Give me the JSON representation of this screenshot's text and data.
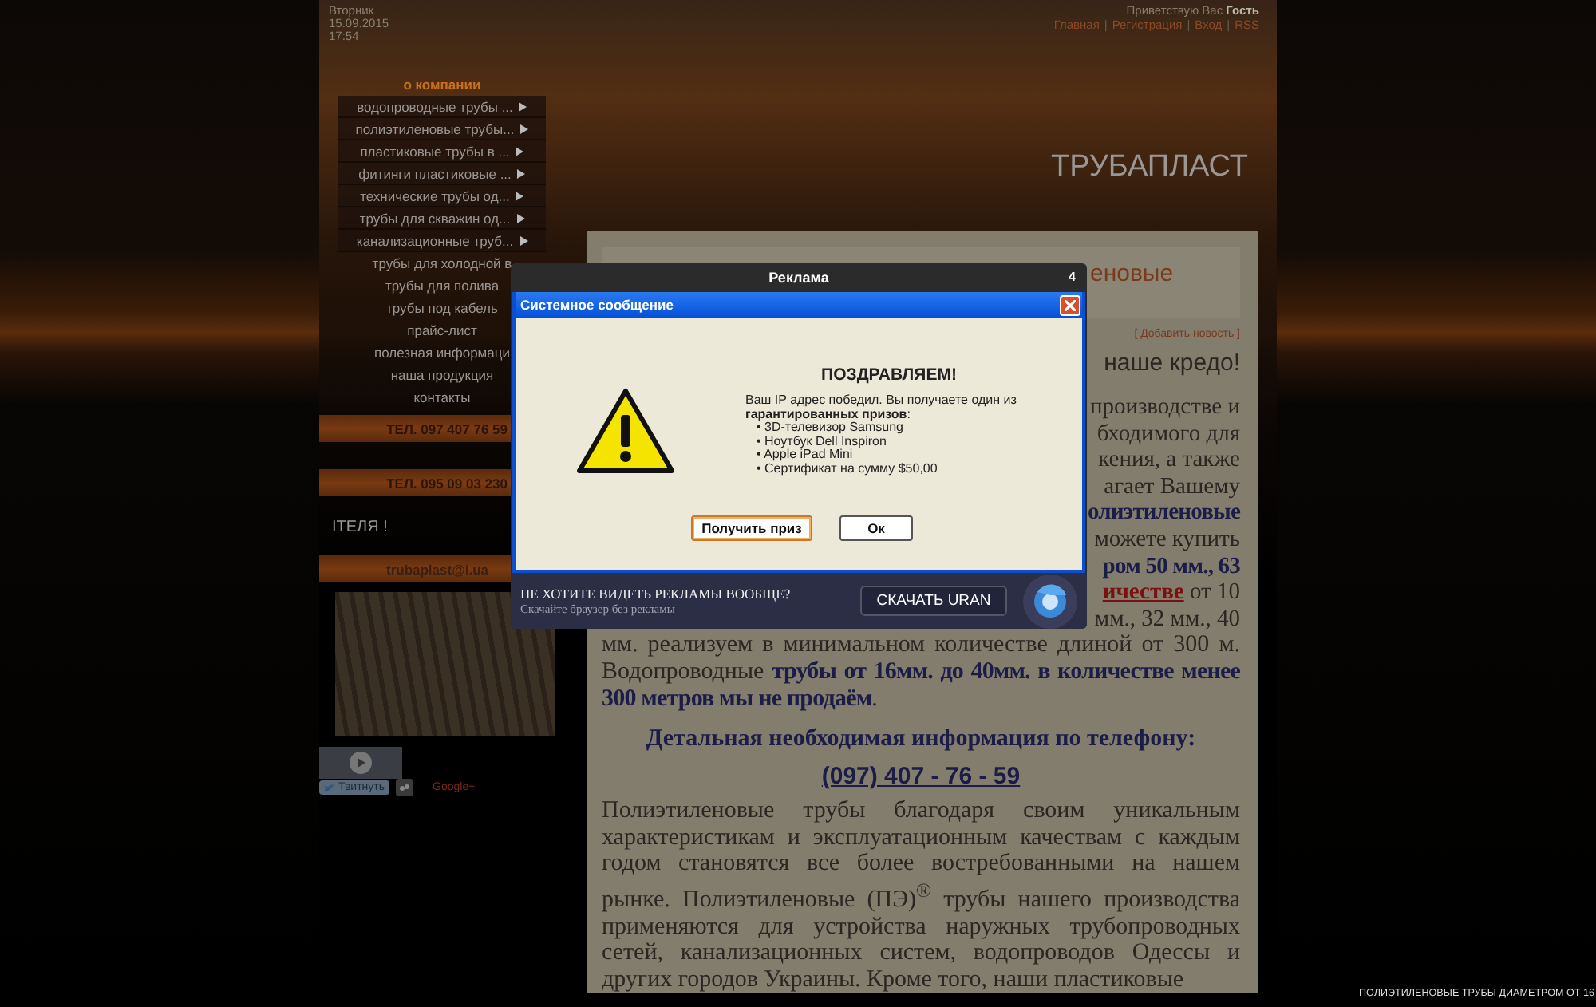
{
  "header": {
    "date": [
      "Вторник",
      "15.09.2015",
      "17:54"
    ],
    "greeting": "Приветствую Вас **Гость**",
    "links": [
      {
        "label": "Главная",
        "kind": "link"
      },
      {
        "label": "|",
        "kind": "separator"
      },
      {
        "label": "Регистрация",
        "kind": "link"
      },
      {
        "label": "|",
        "kind": "separator"
      },
      {
        "label": "Вход",
        "kind": "link"
      },
      {
        "label": "|",
        "kind": "separator"
      },
      {
        "label": "RSS",
        "kind": "link"
      }
    ],
    "site_title": "ТРУБАПЛАСТ"
  },
  "sidebar": {
    "menu": [
      {
        "label": "о компании",
        "selected": true,
        "submenu": false
      },
      {
        "label": "водопроводные трубы ...",
        "selected": false,
        "submenu": true
      },
      {
        "label": "полиэтиленовые трубы...",
        "selected": false,
        "submenu": true
      },
      {
        "label": "пластиковые трубы в ...",
        "selected": false,
        "submenu": true
      },
      {
        "label": "фитинги пластиковые ...",
        "selected": false,
        "submenu": true
      },
      {
        "label": "технические трубы од...",
        "selected": false,
        "submenu": true
      },
      {
        "label": "трубы для скважин од...",
        "selected": false,
        "submenu": true
      },
      {
        "label": "канализационные труб...",
        "selected": false,
        "submenu": true
      },
      {
        "label": "трубы для холодной в",
        "selected": false,
        "submenu": false
      },
      {
        "label": "трубы для полива",
        "selected": false,
        "submenu": false
      },
      {
        "label": "трубы под кабель",
        "selected": false,
        "submenu": false
      },
      {
        "label": "прайс-лист",
        "selected": false,
        "submenu": false
      },
      {
        "label": "полезная информаци",
        "selected": false,
        "submenu": false
      },
      {
        "label": "наша продукция",
        "selected": false,
        "submenu": false
      },
      {
        "label": "контакты",
        "selected": false,
        "submenu": false
      }
    ],
    "phones": [
      "ТЕЛ. 097 407 76 59",
      "ТЕЛ. 095 09 03 230"
    ],
    "marquee": "ІТЕЛЯ !",
    "email": "trubaplast@i.ua",
    "tweet": "Твитнуть",
    "google": "Google+"
  },
  "content": {
    "heading_fragment": "еновые",
    "add_news": "[ Добавить новость ]",
    "motto_fragment": "наше кредо!",
    "fragment_lines": [
      [
        {
          "text": "производстве и",
          "kind": "plain"
        }
      ],
      [
        {
          "text": "бходимого для",
          "kind": "plain"
        }
      ],
      [
        {
          "text": "кения, а также",
          "kind": "plain"
        }
      ],
      [
        {
          "text": "агает Вашему",
          "kind": "plain"
        }
      ],
      [
        {
          "text": "олиэтиленовые",
          "kind": "strong"
        }
      ],
      [
        {
          "text": "можете купить",
          "kind": "plain"
        }
      ],
      [
        {
          "text": "ром 50 мм., 63",
          "kind": "strong"
        }
      ],
      [
        {
          "text": "ичестве",
          "kind": "link"
        },
        {
          "text": " от 10",
          "kind": "plain"
        }
      ],
      [
        {
          "text": "мм., 32 мм., 40",
          "kind": "plain"
        }
      ]
    ],
    "paragraph_tail": [
      {
        "text": "мм. реализуем в минимальном количестве длиной от 300 м. Водопроводные ",
        "kind": "plain"
      },
      {
        "text": "трубы от 16мм. до 40мм. в количестве менее 300 метров мы не продаём",
        "kind": "strong"
      },
      {
        "text": ".",
        "kind": "plain"
      }
    ],
    "info_heading": "Детальная необходимая информация по телефону:",
    "phone_link": "(097) 407 - 76 - 59",
    "body": "Полиэтиленовые трубы благодаря своим уникальным характеристикам и эксплуатационным качествам с каждым годом становятся все более востребованными на нашем рынке. Полиэтиленовые (ПЭ)$^{®}$ трубы нашего производства применяются для устройства наружных трубопроводных сетей, канализационных систем, водопроводов Одессы и других городов Украины. Кроме того, наши пластиковые"
  },
  "ad_overlay": {
    "title": "Реклама",
    "counter": "4",
    "dialog": {
      "title": "Системное сообщение",
      "heading": "ПОЗДРАВЛЯЕМ!",
      "message": "Ваш IP адрес победил. Вы получаете один из **гарантированных призов**:",
      "prizes": [
        "• 3D-телевизор Samsung",
        "• Ноутбук Dell Inspiron",
        "• Apple iPad Mini",
        "• Сертификат на сумму $50,00"
      ],
      "buttons": [
        {
          "label": "Получить приз",
          "selected": true
        },
        {
          "label": "Ок",
          "selected": false
        }
      ]
    },
    "promo_title": "НЕ ХОТИТЕ ВИДЕТЬ РЕКЛАМЫ ВООБЩЕ?",
    "promo_sub": "Скачайте браузер без рекламы",
    "promo_button": "СКАЧАТЬ URAN"
  },
  "ticker": "ПОЛИЭТИЛЕНОВЫЕ ТРУБЫ ДИАМЕТРОМ ОТ 16"
}
